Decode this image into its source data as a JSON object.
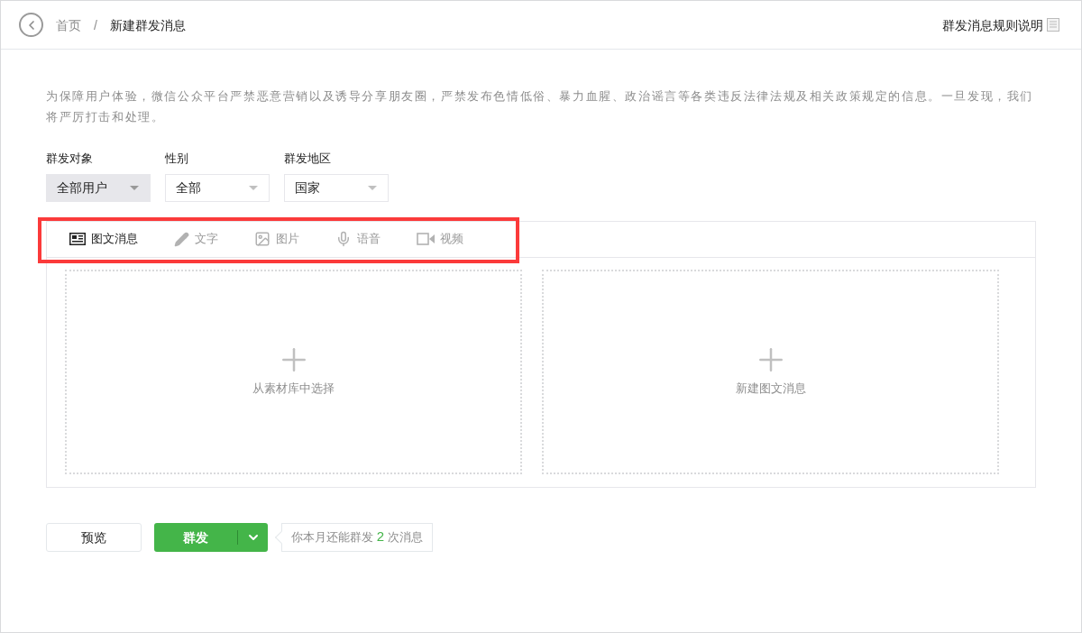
{
  "breadcrumb": {
    "home": "首页",
    "separator": "/",
    "current": "新建群发消息"
  },
  "rules_link": "群发消息规则说明",
  "notice": "为保障用户体验，微信公众平台严禁恶意营销以及诱导分享朋友圈，严禁发布色情低俗、暴力血腥、政治谣言等各类违反法律法规及相关政策规定的信息。一旦发现，我们将严厉打击和处理。",
  "filters": [
    {
      "label": "群发对象",
      "value": "全部用户",
      "disabled": true
    },
    {
      "label": "性别",
      "value": "全部",
      "disabled": false
    },
    {
      "label": "群发地区",
      "value": "国家",
      "disabled": false
    }
  ],
  "tabs": [
    {
      "kind": "news",
      "label": "图文消息",
      "selected": true
    },
    {
      "kind": "text",
      "label": "文字",
      "selected": false
    },
    {
      "kind": "image",
      "label": "图片",
      "selected": false
    },
    {
      "kind": "voice",
      "label": "语音",
      "selected": false
    },
    {
      "kind": "video",
      "label": "视频",
      "selected": false
    }
  ],
  "cards": [
    {
      "label": "从素材库中选择"
    },
    {
      "label": "新建图文消息"
    }
  ],
  "preview_button": "预览",
  "send_button": "群发",
  "quota": {
    "prefix": "你本月还能群发",
    "count": "2",
    "suffix": "次消息"
  }
}
